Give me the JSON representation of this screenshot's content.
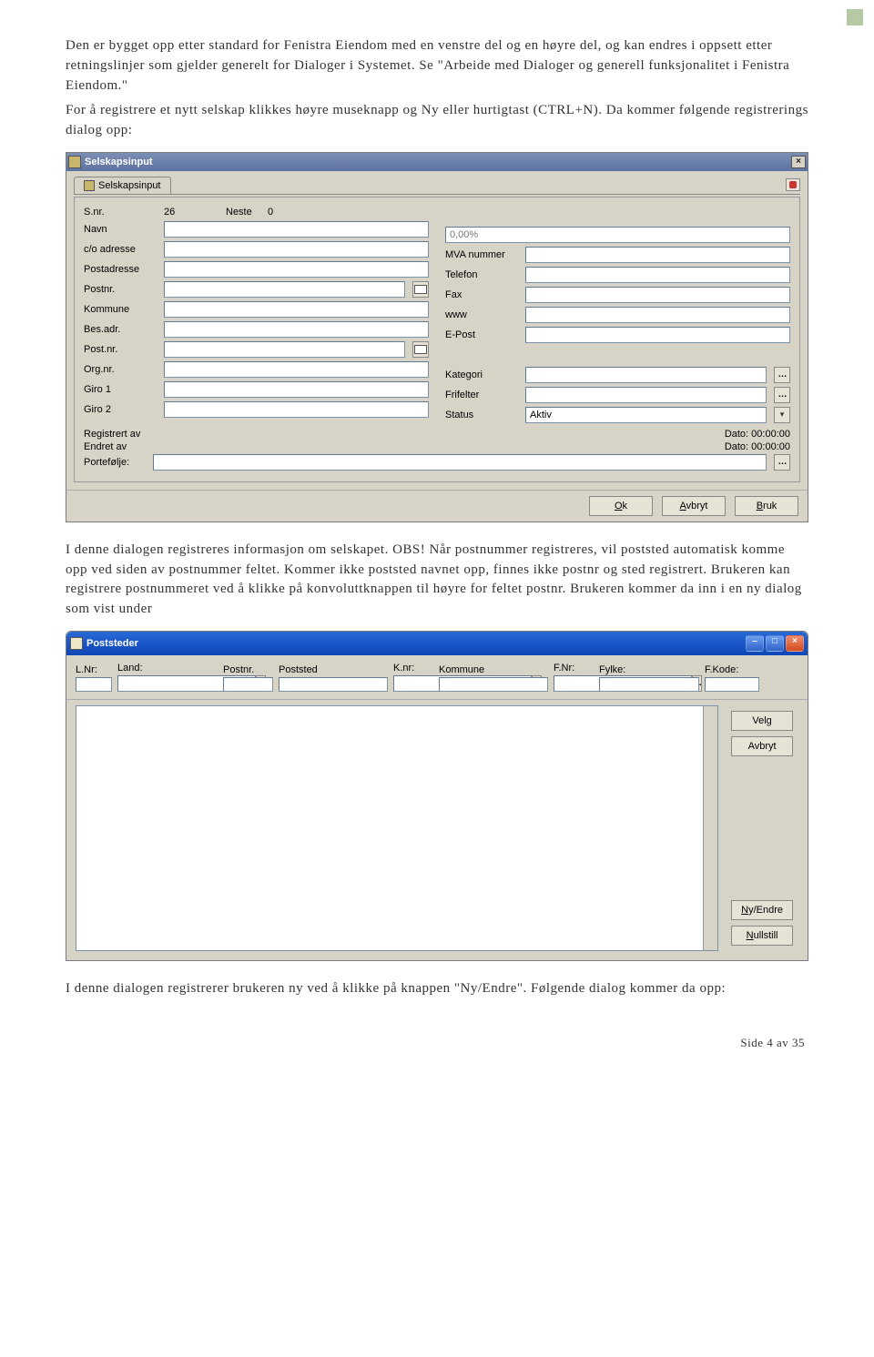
{
  "page_marker": true,
  "paragraphs": {
    "p1": "Den er bygget opp etter standard for Fenistra Eiendom med en venstre del og en høyre del, og kan endres i oppsett etter retningslinjer som gjelder generelt for Dialoger i Systemet. Se \"Arbeide med Dialoger og generell funksjonalitet i Fenistra Eiendom.\"",
    "p2": "For å registrere et nytt selskap klikkes høyre museknapp og Ny eller hurtigtast (CTRL+N). Da kommer følgende registrerings dialog opp:",
    "p3": "I denne dialogen registreres informasjon om selskapet. OBS! Når postnummer registreres, vil poststed automatisk komme opp ved siden av postnummer feltet. Kommer ikke poststed navnet opp, finnes ikke postnr og sted registrert. Brukeren kan registrere postnummeret ved å klikke på konvoluttknappen til høyre for feltet postnr. Brukeren kommer da inn i en ny dialog som vist under",
    "p4": "I denne dialogen registrerer brukeren ny ved å klikke på knappen \"Ny/Endre\". Følgende dialog kommer da opp:"
  },
  "dialog1": {
    "title": "Selskapsinput",
    "tab": "Selskapsinput",
    "fields": {
      "snr_label": "S.nr.",
      "snr_value": "26",
      "neste_label": "Neste",
      "neste_value": "0",
      "navn": "Navn",
      "co": "c/o adresse",
      "postadr": "Postadresse",
      "postnr": "Postnr.",
      "kommune": "Kommune",
      "besadr": "Bes.adr.",
      "postnr2": "Post.nr.",
      "orgnr": "Org.nr.",
      "giro1": "Giro 1",
      "giro2": "Giro 2",
      "pct_placeholder": "0,00%",
      "mva": "MVA nummer",
      "telefon": "Telefon",
      "fax": "Fax",
      "www": "www",
      "epost": "E-Post",
      "kategori": "Kategori",
      "frifelter": "Frifelter",
      "status": "Status",
      "status_value": "Aktiv",
      "reg_av": "Registrert av",
      "endret_av": "Endret av",
      "portefolje": "Portefølje:",
      "dato_label": "Dato:",
      "dato_value": "00:00:00"
    },
    "buttons": {
      "ok": "Ok",
      "avbryt": "Avbryt",
      "bruk": "Bruk"
    }
  },
  "dialog2": {
    "title": "Poststeder",
    "header": {
      "lnr": "L.Nr:",
      "land": "Land:",
      "postnr": "Postnr.",
      "poststed": "Poststed",
      "knr": "K.nr:",
      "kommune": "Kommune",
      "fnr": "F.Nr:",
      "fylke": "Fylke:",
      "fkode": "F.Kode:"
    },
    "buttons": {
      "velg": "Velg",
      "avbryt": "Avbryt",
      "nyendre": "Ny/Endre",
      "nullstill": "Nullstill"
    }
  },
  "footer": "Side 4 av 35"
}
